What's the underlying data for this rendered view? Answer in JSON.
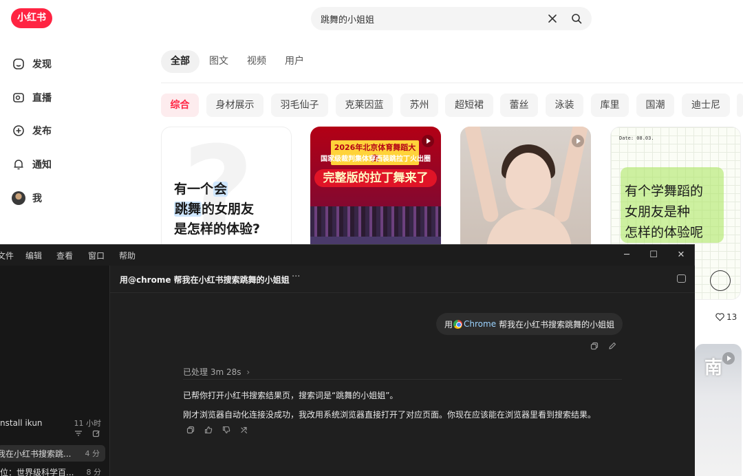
{
  "xhs": {
    "logo_text": "小红书",
    "search": {
      "value": "跳舞的小姐姐",
      "placeholder": ""
    },
    "sidebar": [
      {
        "label": "发现",
        "icon": "discover-icon"
      },
      {
        "label": "直播",
        "icon": "live-icon"
      },
      {
        "label": "发布",
        "icon": "publish-icon"
      },
      {
        "label": "通知",
        "icon": "bell-icon"
      },
      {
        "label": "我",
        "icon": "avatar"
      }
    ],
    "tabs": [
      "全部",
      "图文",
      "视频",
      "用户"
    ],
    "chips": [
      "综合",
      "身材展示",
      "羽毛仙子",
      "克莱因蓝",
      "苏州",
      "超短裙",
      "蕾丝",
      "泳装",
      "库里",
      "国潮",
      "迪士尼"
    ],
    "cards": [
      {
        "line1": "有一个",
        "line1_hl": "会",
        "line2_hl": "跳舞",
        "line2": "的女朋友",
        "line3": "是怎样的体验?"
      },
      {
        "banner_a": "2026年北京体育舞蹈大赛",
        "banner_b": "国家级裁判集体穿西装跳拉丁火出圈",
        "banner_c": "完整版的拉丁舞来了"
      },
      {},
      {
        "date": "Date: 08.03.",
        "line1": "有个学舞蹈的",
        "line2": "女朋友是种",
        "line3": "怎样的体验呢"
      }
    ],
    "like_count": "13",
    "card6_text": "南"
  },
  "app": {
    "menu": [
      "文件",
      "编辑",
      "查看",
      "窗口",
      "帮助"
    ],
    "window_controls": {
      "minimize": "─",
      "maximize": "☐",
      "close": "✕"
    },
    "sidebar_threads": [
      {
        "title": "nstall ikun",
        "time": "11 小时"
      },
      {
        "title": "我在小红书搜索跳...",
        "time": "4 分"
      },
      {
        "title": "位：世界级科学百...",
        "time": "8 分"
      }
    ],
    "conversation": {
      "title": "用@chrome 帮我在小红书搜索跳舞的小姐姐",
      "more": "···",
      "user_prefix": "用",
      "user_chrome": "Chrome",
      "user_suffix": "帮我在小红书搜索跳舞的小姐姐",
      "processed": "已处理 3m 28s",
      "reply_1": "已帮你打开小红书搜索结果页，搜索词是“跳舞的小姐姐”。",
      "reply_2": "刚才浏览器自动化连接没成功，我改用系统浏览器直接打开了对应页面。你现在应该能在浏览器里看到搜索结果。"
    }
  },
  "colors": {
    "brand": "#ff2442",
    "dark_bg": "#1c1c1c"
  }
}
